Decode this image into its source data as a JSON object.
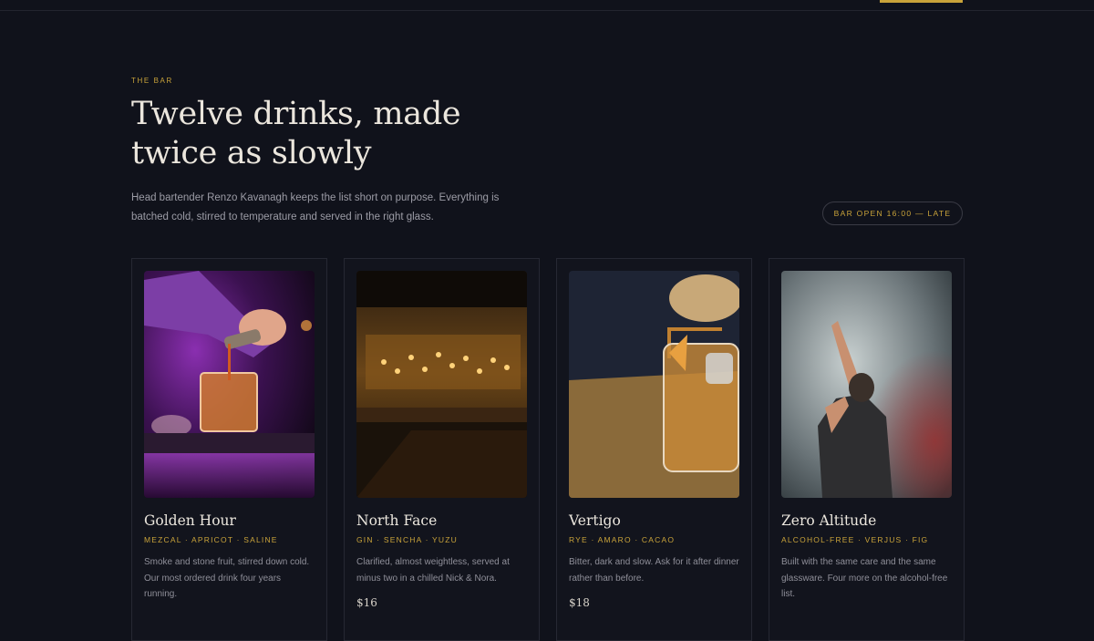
{
  "header": {
    "accent_color": "#c9a33a"
  },
  "section": {
    "eyebrow": "THE BAR",
    "title": "Twelve drinks, made twice as slowly",
    "lede": "Head bartender Renzo Kavanagh keeps the list short on purpose. Everything is batched cold, stirred to temperature and served in the right glass.",
    "badge": "BAR OPEN 16:00 — LATE"
  },
  "colors": {
    "background": "#10121b",
    "accent": "#c9a33a",
    "card_border": "#262833"
  },
  "drinks": [
    {
      "name": "Golden Hour",
      "tags": "MEZCAL · APRICOT · SALINE",
      "description": "Smoke and stone fruit, stirred down cold. Our most ordered drink four years running.",
      "price": "",
      "photo": "bartender-pouring-purple-light"
    },
    {
      "name": "North Face",
      "tags": "GIN · SENCHA · YUZU",
      "description": "Clarified, almost weightless, served at minus two in a chilled Nick & Nora.",
      "price": "$16",
      "photo": "bar-interior-hanging-lights"
    },
    {
      "name": "Vertigo",
      "tags": "RYE · AMARO · CACAO",
      "description": "Bitter, dark and slow. Ask for it after dinner rather than before.",
      "price": "$18",
      "photo": "strainer-pouring-over-ice"
    },
    {
      "name": "Zero Altitude",
      "tags": "ALCOHOL-FREE · VERJUS · FIG",
      "description": "Built with the same care and the same glassware. Four more on the alcohol-free list.",
      "price": "",
      "photo": "bartender-in-smoke"
    }
  ]
}
